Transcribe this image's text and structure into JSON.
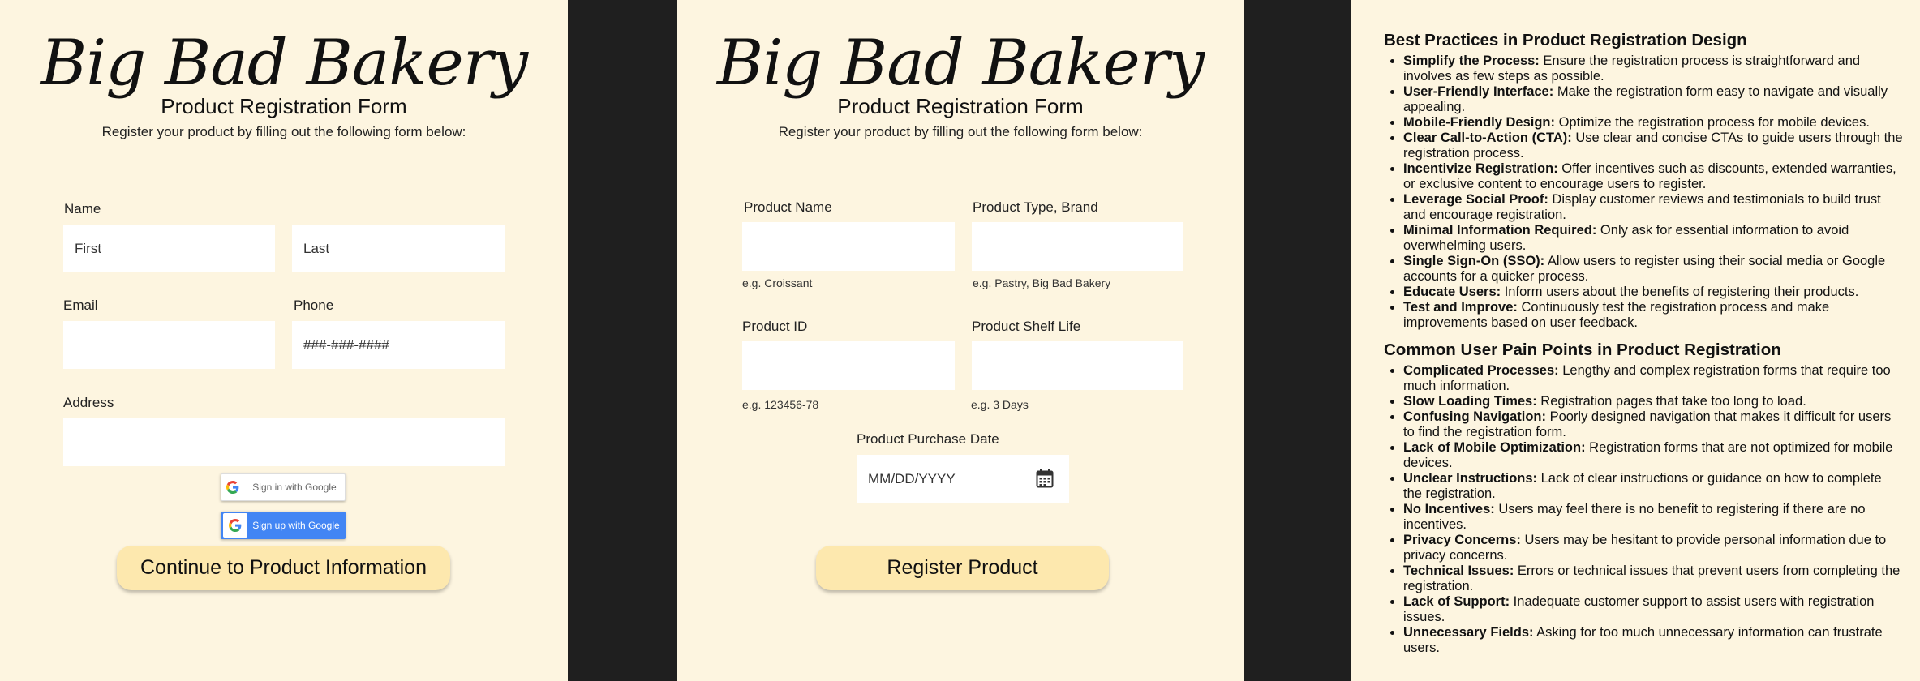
{
  "form1": {
    "brand": "Big Bad Bakery",
    "title": "Product Registration Form",
    "intro": "Register your product by filling out the following form below:",
    "name_label": "Name",
    "first_placeholder": "First",
    "last_placeholder": "Last",
    "email_label": "Email",
    "email_placeholder": "",
    "phone_label": "Phone",
    "phone_placeholder": "###-###-####",
    "address_label": "Address",
    "address_placeholder": "",
    "google_signin": "Sign in with Google",
    "google_signup": "Sign up with Google",
    "continue_label": "Continue to Product Information"
  },
  "form2": {
    "brand": "Big Bad Bakery",
    "title": "Product Registration Form",
    "intro": "Register your product by filling out the following form below:",
    "product_name_label": "Product Name",
    "product_name_hint": "e.g. Croissant",
    "product_type_label": "Product Type, Brand",
    "product_type_hint": "e.g. Pastry, Big Bad Bakery",
    "product_id_label": "Product ID",
    "product_id_hint": "e.g. 123456-78",
    "shelf_life_label": "Product Shelf Life",
    "shelf_life_hint": "e.g. 3 Days",
    "purchase_date_label": "Product Purchase Date",
    "purchase_date_placeholder": "MM/DD/YYYY",
    "register_label": "Register Product"
  },
  "article": {
    "best_practices": {
      "heading": "Best Practices in Product Registration Design",
      "items": [
        {
          "term": "Simplify the Process:",
          "text": " Ensure the registration process is straightforward and involves as few steps as possible."
        },
        {
          "term": "User-Friendly Interface:",
          "text": " Make the registration form easy to navigate and visually appealing."
        },
        {
          "term": "Mobile-Friendly Design:",
          "text": " Optimize the registration process for mobile devices."
        },
        {
          "term": "Clear Call-to-Action (CTA):",
          "text": " Use clear and concise CTAs to guide users through the registration process."
        },
        {
          "term": "Incentivize Registration:",
          "text": " Offer incentives such as discounts, extended warranties, or exclusive content to encourage users to register."
        },
        {
          "term": "Leverage Social Proof:",
          "text": " Display customer reviews and testimonials to build trust and encourage registration."
        },
        {
          "term": "Minimal Information Required:",
          "text": " Only ask for essential information to avoid overwhelming users."
        },
        {
          "term": "Single Sign-On (SSO):",
          "text": " Allow users to register using their social media or Google accounts for a quicker process."
        },
        {
          "term": "Educate Users:",
          "text": " Inform users about the benefits of registering their products."
        },
        {
          "term": "Test and Improve:",
          "text": " Continuously test the registration process and make improvements based on user feedback."
        }
      ]
    },
    "pain_points": {
      "heading": "Common User Pain Points in Product Registration",
      "items": [
        {
          "term": "Complicated Processes:",
          "text": " Lengthy and complex registration forms that require too much information."
        },
        {
          "term": "Slow Loading Times:",
          "text": " Registration pages that take too long to load."
        },
        {
          "term": "Confusing Navigation:",
          "text": " Poorly designed navigation that makes it difficult for users to find the registration form."
        },
        {
          "term": "Lack of Mobile Optimization:",
          "text": " Registration forms that are not optimized for mobile devices."
        },
        {
          "term": "Unclear Instructions:",
          "text": " Lack of clear instructions or guidance on how to complete the registration."
        },
        {
          "term": "No Incentives:",
          "text": " Users may feel there is no benefit to registering if there are no incentives."
        },
        {
          "term": "Privacy Concerns:",
          "text": " Users may be hesitant to provide personal information due to privacy concerns."
        },
        {
          "term": "Technical Issues:",
          "text": " Errors or technical issues that prevent users from completing the registration."
        },
        {
          "term": "Lack of Support:",
          "text": " Inadequate customer support to assist users with registration issues."
        },
        {
          "term": "Unnecessary Fields:",
          "text": " Asking for too much unnecessary information can frustrate users."
        }
      ]
    }
  },
  "icons": {
    "google_logo": "google-g-icon",
    "calendar": "calendar-icon"
  },
  "colors": {
    "panel_bg": "#fdf5e0",
    "divider_bg": "#1f1f1f",
    "cta_bg": "#fde8ae",
    "google_blue": "#4285f4"
  }
}
